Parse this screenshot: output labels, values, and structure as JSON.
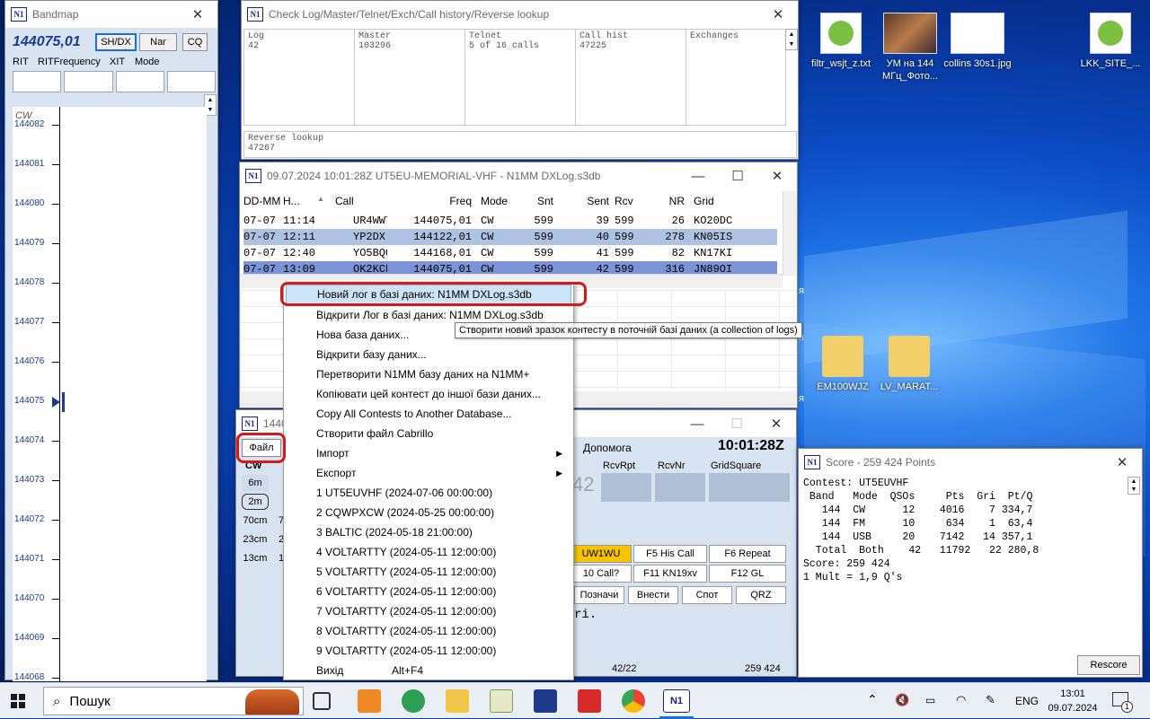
{
  "bandmap": {
    "title": "Bandmap",
    "freq": "144075,01",
    "btn_shdx": "SH/DX",
    "btn_nar": "Nar",
    "btn_cq": "CQ",
    "lbl_rit": "RIT",
    "lbl_ritfreq": "RITFrequency",
    "lbl_xit": "XIT",
    "lbl_mode": "Mode",
    "mode": "CW",
    "ticks": [
      "144082",
      "144081",
      "144080",
      "144079",
      "144078",
      "144077",
      "144076",
      "144075",
      "144074",
      "144073",
      "144072",
      "144071",
      "144070",
      "144069",
      "144068"
    ]
  },
  "checklog": {
    "title": "Check Log/Master/Telnet/Exch/Call history/Reverse lookup",
    "log_label": "Log",
    "log_value": "42",
    "master_label": "Master",
    "master_value": "103296",
    "telnet_label": "Telnet",
    "telnet_value": "5 of 16 calls",
    "callhist_label": "Call hist",
    "callhist_value": "47225",
    "exch_label": "Exchanges",
    "reverse_label": "Reverse lookup",
    "reverse_value": "47267"
  },
  "logwin": {
    "title": "09.07.2024 10:01:28Z  UT5EU-MEMORIAL-VHF - N1MM DXLog.s3db",
    "headers": [
      "DD-MM",
      "H...",
      "Call",
      "Freq",
      "Mode",
      "Snt",
      "Sent",
      "Rcv",
      "NR",
      "Grid"
    ],
    "rows": [
      [
        "07-07",
        "11:14",
        "UR4WWT",
        "144075,01",
        "CW",
        "599",
        "39",
        "599",
        "26",
        "KO20DC"
      ],
      [
        "07-07",
        "12:11",
        "YP2DX",
        "144122,01",
        "CW",
        "599",
        "40",
        "599",
        "278",
        "KN05IS"
      ],
      [
        "07-07",
        "12:40",
        "YO5BQQ/P",
        "144168,01",
        "CW",
        "599",
        "41",
        "599",
        "82",
        "KN17KI"
      ],
      [
        "07-07",
        "13:09",
        "OK2KCN",
        "144075,01",
        "CW",
        "599",
        "42",
        "599",
        "316",
        "JN89OI"
      ]
    ]
  },
  "menu": {
    "items": [
      "Новий лог в базі даних: N1MM DXLog.s3db",
      "Відкрити Лог в базі даних: N1MM DXLog.s3db",
      "Нова база даних...",
      "Відкрити базу даних...",
      "Перетворити N1MM базу даних на N1MM+",
      "Копіювати цей контест до іншої бази даних...",
      "Copy All Contests to Another Database...",
      "Створити файл Cabrillo",
      "Імпорт",
      "Експорт",
      "1 UT5EUVHF (2024-07-06 00:00:00)",
      "2 CQWPXCW (2024-05-25 00:00:00)",
      "3 BALTIC (2024-05-18 21:00:00)",
      "4 VOLTARTTY (2024-05-11 12:00:00)",
      "5 VOLTARTTY (2024-05-11 12:00:00)",
      "6 VOLTARTTY (2024-05-11 12:00:00)",
      "7 VOLTARTTY (2024-05-11 12:00:00)",
      "8 VOLTARTTY (2024-05-11 12:00:00)",
      "9 VOLTARTTY (2024-05-11 12:00:00)",
      "Вихід"
    ],
    "exit_shortcut": "Alt+F4",
    "tooltip": "Створити новий зразок контесту в поточній базі даних (a collection of logs)"
  },
  "entry": {
    "title_fragment": "1440",
    "menu_file": "Файл",
    "menu_help": "Допомога",
    "clock": "10:01:28Z",
    "mode": "CW",
    "bands": [
      "6m",
      "2m",
      "70cm",
      "23cm",
      "13cm"
    ],
    "bands_fragments": [
      "7",
      "2",
      "1"
    ],
    "col_rcvrpt": "RcvRpt",
    "col_rcvnr": "RcvNr",
    "col_grid": "GridSquare",
    "ghost_value": "42",
    "fkeys": [
      "UW1WU",
      "F5 His Call",
      "F6 Repeat",
      "10 Call?",
      "F11 KN19xv",
      "F12 GL",
      "Позначи",
      "Внести",
      "Спот",
      "QRZ"
    ],
    "text_fragment": "ri.",
    "status_qsos": "42/22",
    "status_points": "259 424"
  },
  "score": {
    "title": "Score - 259 424 Points",
    "text": "Contest: UT5EUVHF\n Band   Mode  QSOs     Pts  Gri  Pt/Q\n   144  CW      12    4016    7 334,7\n   144  FM      10     634    1  63,4\n   144  USB     20    7142   14 357,1\n  Total  Both    42   11792   22 280,8\nScore: 259 424\n1 Mult = 1,9 Q's",
    "rescore": "Rescore"
  },
  "desktop": {
    "icons": [
      "filtr_wsjt_z.txt",
      "УМ на 144 МГц_Фото...",
      "collins 30s1.jpg",
      "LKK_SITE_...",
      "EM100WJZ",
      "LV_MARAT..."
    ],
    "edge_fragments": [
      "я",
      "я",
      "я"
    ]
  },
  "taskbar": {
    "search": "Пошук",
    "lang": "ENG",
    "time": "13:01",
    "date": "09.07.2024",
    "notif_count": "1"
  },
  "colors": {
    "row_selected": "#aec3e4",
    "row_focused": "#7c93d9",
    "panel_blue": "#d8e4f2",
    "highlight_red": "#d61a1a",
    "menu_hover": "#cce4f7"
  }
}
